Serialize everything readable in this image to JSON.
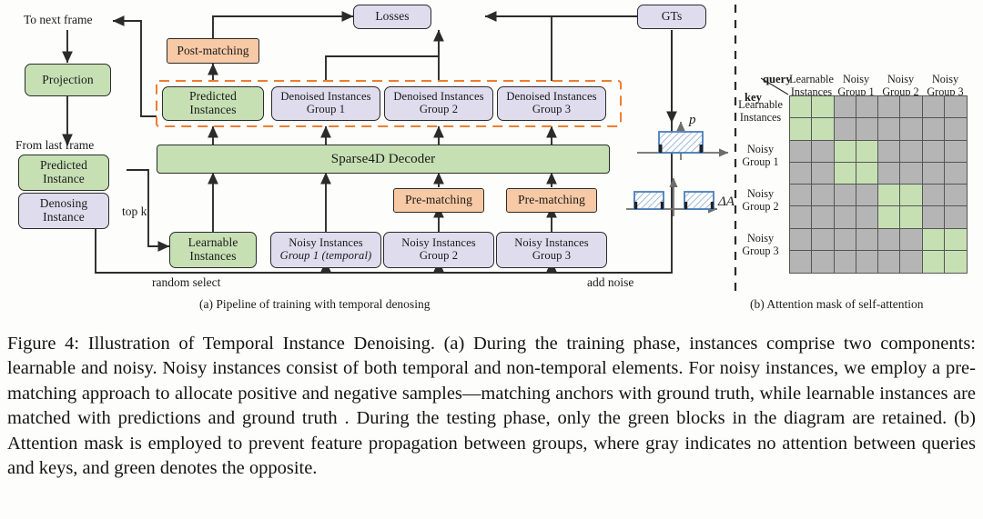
{
  "figure": {
    "caption": "Figure 4: Illustration of Temporal Instance Denoising. (a) During the training phase, instances comprise two components: learnable and noisy. Noisy instances consist of both temporal and non-temporal elements. For noisy instances, we employ a pre-matching approach to allocate positive and negative samples—matching anchors with ground truth, while learnable instances are matched with predictions and ground truth . During the testing phase, only the green blocks in the diagram are retained. (b) Attention mask is employed to prevent feature propagation between groups, where gray indicates no attention between queries and keys, and green denotes the opposite.",
    "subcaption_a": "(a) Pipeline of training with temporal denosing",
    "subcaption_b": "(b) Attention mask of self-attention"
  },
  "colors": {
    "green": "#c6e0b4",
    "purple": "#dedced",
    "orange": "#f7c9a5",
    "gray_cell": "#b5b5b5",
    "dashed_accent": "#ed7d31",
    "stroke": "#2b2b2b",
    "hatch_blue": "#4a7ebb"
  },
  "pipeline": {
    "nodes": {
      "projection": {
        "lines": [
          "Projection"
        ],
        "style": "green"
      },
      "predicted_instance": {
        "lines": [
          "Predicted",
          "Instance"
        ],
        "style": "green"
      },
      "denosing_instance": {
        "lines": [
          "Denosing",
          "Instance"
        ],
        "style": "purple"
      },
      "learnable_instances": {
        "lines": [
          "Learnable",
          "Instances"
        ],
        "style": "green"
      },
      "noisy_group_1": {
        "lines": [
          "Noisy Instances",
          "Group 1 (temporal)"
        ],
        "italic_line": 1,
        "style": "purple"
      },
      "noisy_group_2": {
        "lines": [
          "Noisy Instances",
          "Group 2"
        ],
        "style": "purple"
      },
      "noisy_group_3": {
        "lines": [
          "Noisy Instances",
          "Group 3"
        ],
        "style": "purple"
      },
      "pre_matching_2": {
        "lines": [
          "Pre-matching"
        ],
        "style": "orange"
      },
      "pre_matching_3": {
        "lines": [
          "Pre-matching"
        ],
        "style": "orange"
      },
      "decoder": {
        "lines": [
          "Sparse4D  Decoder"
        ],
        "style": "green"
      },
      "predicted_instances": {
        "lines": [
          "Predicted",
          "Instances"
        ],
        "style": "green"
      },
      "denoised_group_1": {
        "lines": [
          "Denoised Instances",
          "Group 1"
        ],
        "style": "purple"
      },
      "denoised_group_2": {
        "lines": [
          "Denoised Instances",
          "Group 2"
        ],
        "style": "purple"
      },
      "denoised_group_3": {
        "lines": [
          "Denoised Instances",
          "Group 3"
        ],
        "style": "purple"
      },
      "post_matching": {
        "lines": [
          "Post-matching"
        ],
        "style": "orange"
      },
      "losses": {
        "lines": [
          "Losses"
        ],
        "style": "purple"
      },
      "gts": {
        "lines": [
          "GTs"
        ],
        "style": "purple"
      }
    },
    "edge_labels": {
      "to_next_frame": "To next frame",
      "from_last_frame": "From last frame",
      "top_k": "top k",
      "random_select": "random select",
      "add_noise": "add noise"
    }
  },
  "insets": {
    "p_plot": {
      "axis_label": "p",
      "bars": [
        {
          "center": 0,
          "width": 1.0,
          "height": 1.0
        }
      ]
    },
    "da_plot": {
      "axis_label": "ΔA",
      "bars": [
        {
          "center": -1.0,
          "width": 0.7,
          "height": 0.7
        },
        {
          "center": 1.0,
          "width": 0.7,
          "height": 0.7
        }
      ]
    }
  },
  "attention_mask": {
    "query_label": "query",
    "key_label": "key",
    "col_headers": [
      {
        "lines": [
          "Learnable",
          "Instances"
        ]
      },
      {
        "lines": [
          "Noisy",
          "Group 1"
        ]
      },
      {
        "lines": [
          "Noisy",
          "Group 2"
        ]
      },
      {
        "lines": [
          "Noisy",
          "Group 3"
        ]
      }
    ],
    "row_headers": [
      {
        "lines": [
          "Learnable",
          "Instances"
        ]
      },
      {
        "lines": [
          "Noisy",
          "Group 1"
        ]
      },
      {
        "lines": [
          "Noisy",
          "Group 2"
        ]
      },
      {
        "lines": [
          "Noisy",
          "Group 3"
        ]
      }
    ],
    "size": 8,
    "cells": [
      [
        1,
        1,
        0,
        0,
        0,
        0,
        0,
        0
      ],
      [
        1,
        1,
        0,
        0,
        0,
        0,
        0,
        0
      ],
      [
        0,
        0,
        1,
        1,
        0,
        0,
        0,
        0
      ],
      [
        0,
        0,
        1,
        1,
        0,
        0,
        0,
        0
      ],
      [
        0,
        0,
        0,
        0,
        1,
        1,
        0,
        0
      ],
      [
        0,
        0,
        0,
        0,
        1,
        1,
        0,
        0
      ],
      [
        0,
        0,
        0,
        0,
        0,
        0,
        1,
        1
      ],
      [
        0,
        0,
        0,
        0,
        0,
        0,
        1,
        1
      ]
    ],
    "legend_meaning": {
      "green": "attention allowed",
      "gray": "no attention"
    }
  }
}
